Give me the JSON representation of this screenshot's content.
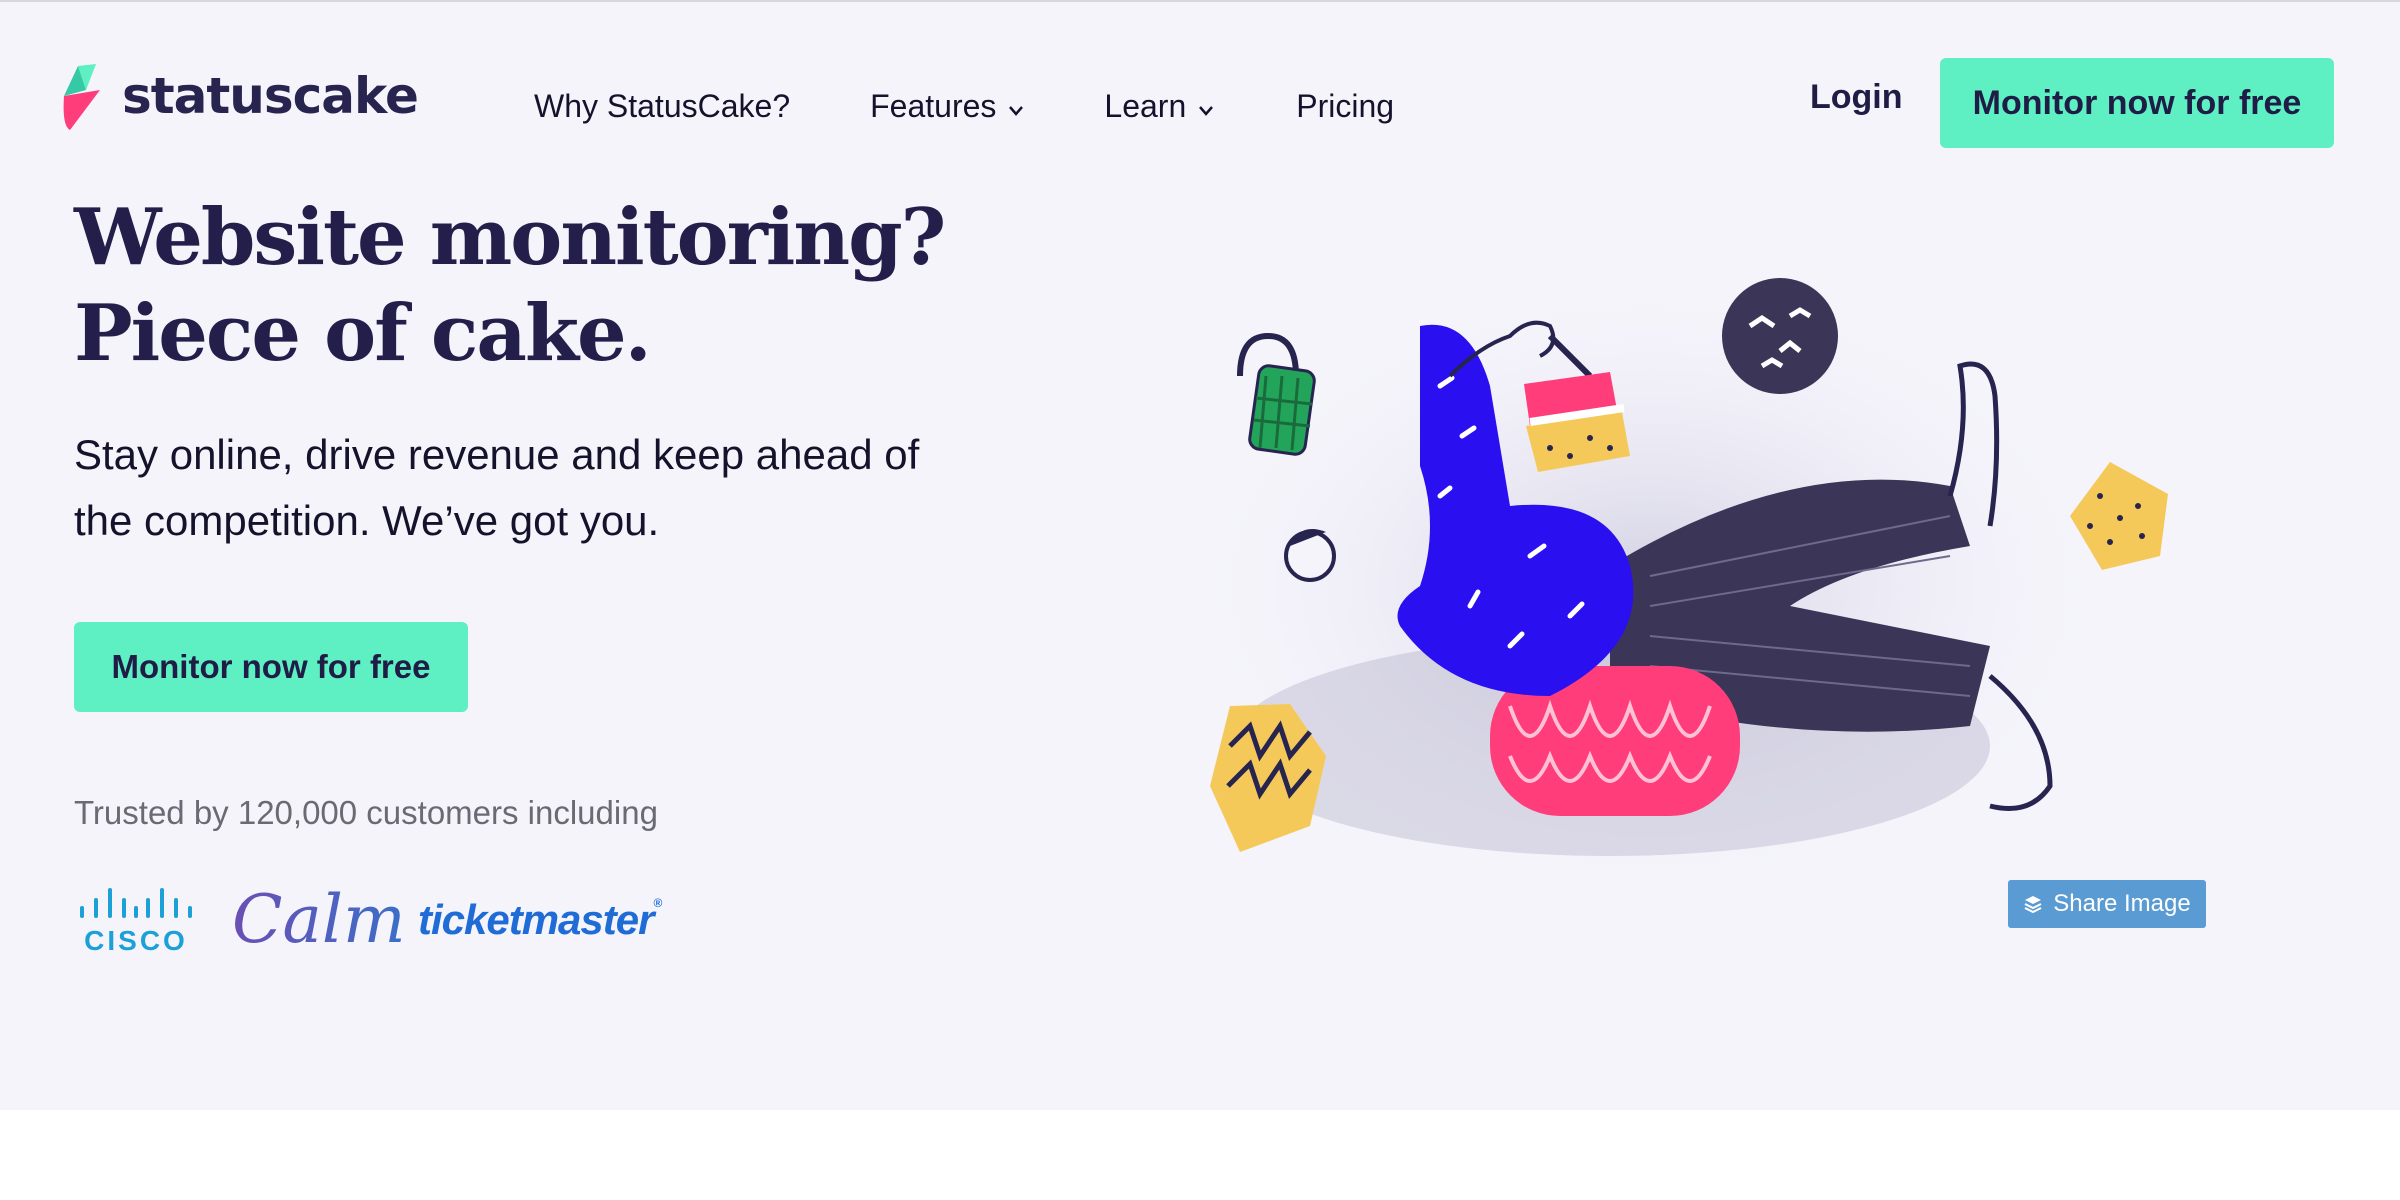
{
  "brand": {
    "name": "statuscake"
  },
  "nav": {
    "items": [
      {
        "label": "Why StatusCake?",
        "has_dropdown": false
      },
      {
        "label": "Features",
        "has_dropdown": true
      },
      {
        "label": "Learn",
        "has_dropdown": true
      },
      {
        "label": "Pricing",
        "has_dropdown": false
      }
    ],
    "login_label": "Login",
    "cta_label": "Monitor now for free"
  },
  "hero": {
    "headline_line1": "Website monitoring?",
    "headline_line2": "Piece of cake.",
    "subtext": "Stay online, drive revenue and keep ahead of the competition. We’ve got you.",
    "cta_label": "Monitor now for free",
    "trusted_text": "Trusted by 120,000 customers including",
    "customer_logos": [
      {
        "name": "cisco",
        "text": "CISCO"
      },
      {
        "name": "calm",
        "text": "Calm"
      },
      {
        "name": "ticketmaster",
        "text": "ticketmaster"
      }
    ]
  },
  "share_button": {
    "label": "Share Image",
    "icon": "layers-icon"
  },
  "colors": {
    "accent": "#5ef0c3",
    "hero_bg": "#f5f4fb",
    "headline": "#231f4a",
    "share_button": "#5b9bd3",
    "illustration_blue": "#2a0ff0",
    "illustration_pink": "#ff3d7a",
    "illustration_yellow": "#f4c95a",
    "illustration_green": "#22a55b",
    "illustration_dark": "#3b3558"
  }
}
